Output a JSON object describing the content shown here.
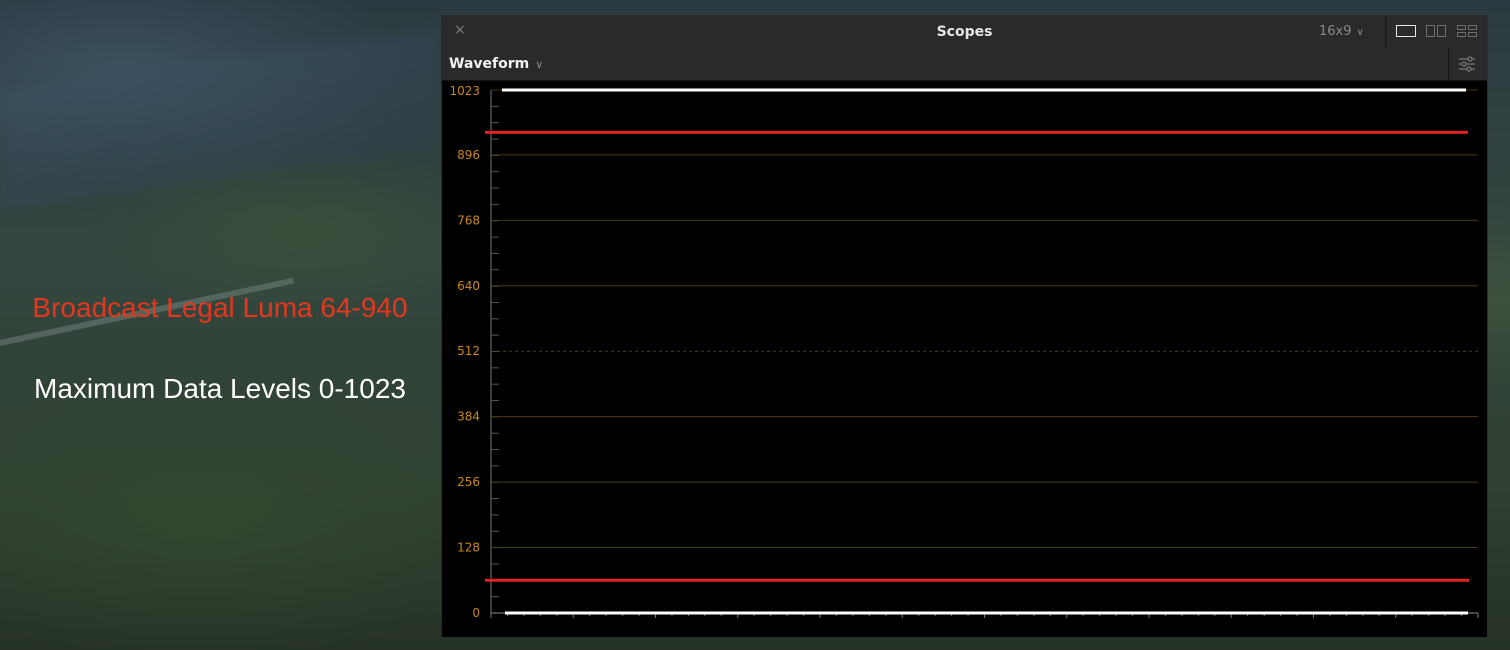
{
  "overlay_text": {
    "broadcast_legal": "Broadcast Legal Luma 64-940",
    "max_levels": "Maximum Data Levels 0-1023"
  },
  "panel": {
    "close_glyph": "×",
    "title": "Scopes",
    "aspect": "16x9",
    "aspect_chevron": "chevron-down-icon",
    "layout_buttons": [
      "single-layout-icon",
      "dual-layout-icon",
      "quad-layout-icon"
    ],
    "active_layout": "single-layout-icon"
  },
  "toolbar": {
    "scope_type": "Waveform",
    "settings_icon": "sliders-icon"
  },
  "colors": {
    "scale_label": "#c8871e",
    "legal_line": "#e0221b",
    "max_line": "#ffffff",
    "grid": "#4a3a14"
  },
  "chart_data": {
    "type": "line",
    "title": "",
    "ylim": [
      0,
      1023
    ],
    "yticks": [
      0,
      128,
      256,
      384,
      512,
      640,
      768,
      896,
      1023
    ],
    "dashed_gridline": 512,
    "series": [
      {
        "values": [
          1023
        ],
        "color": "#ffffff"
      },
      {
        "values": [
          940
        ],
        "color": "#e0221b"
      },
      {
        "values": [
          64
        ],
        "color": "#e0221b"
      },
      {
        "values": [
          0
        ],
        "color": "#ffffff"
      }
    ]
  }
}
